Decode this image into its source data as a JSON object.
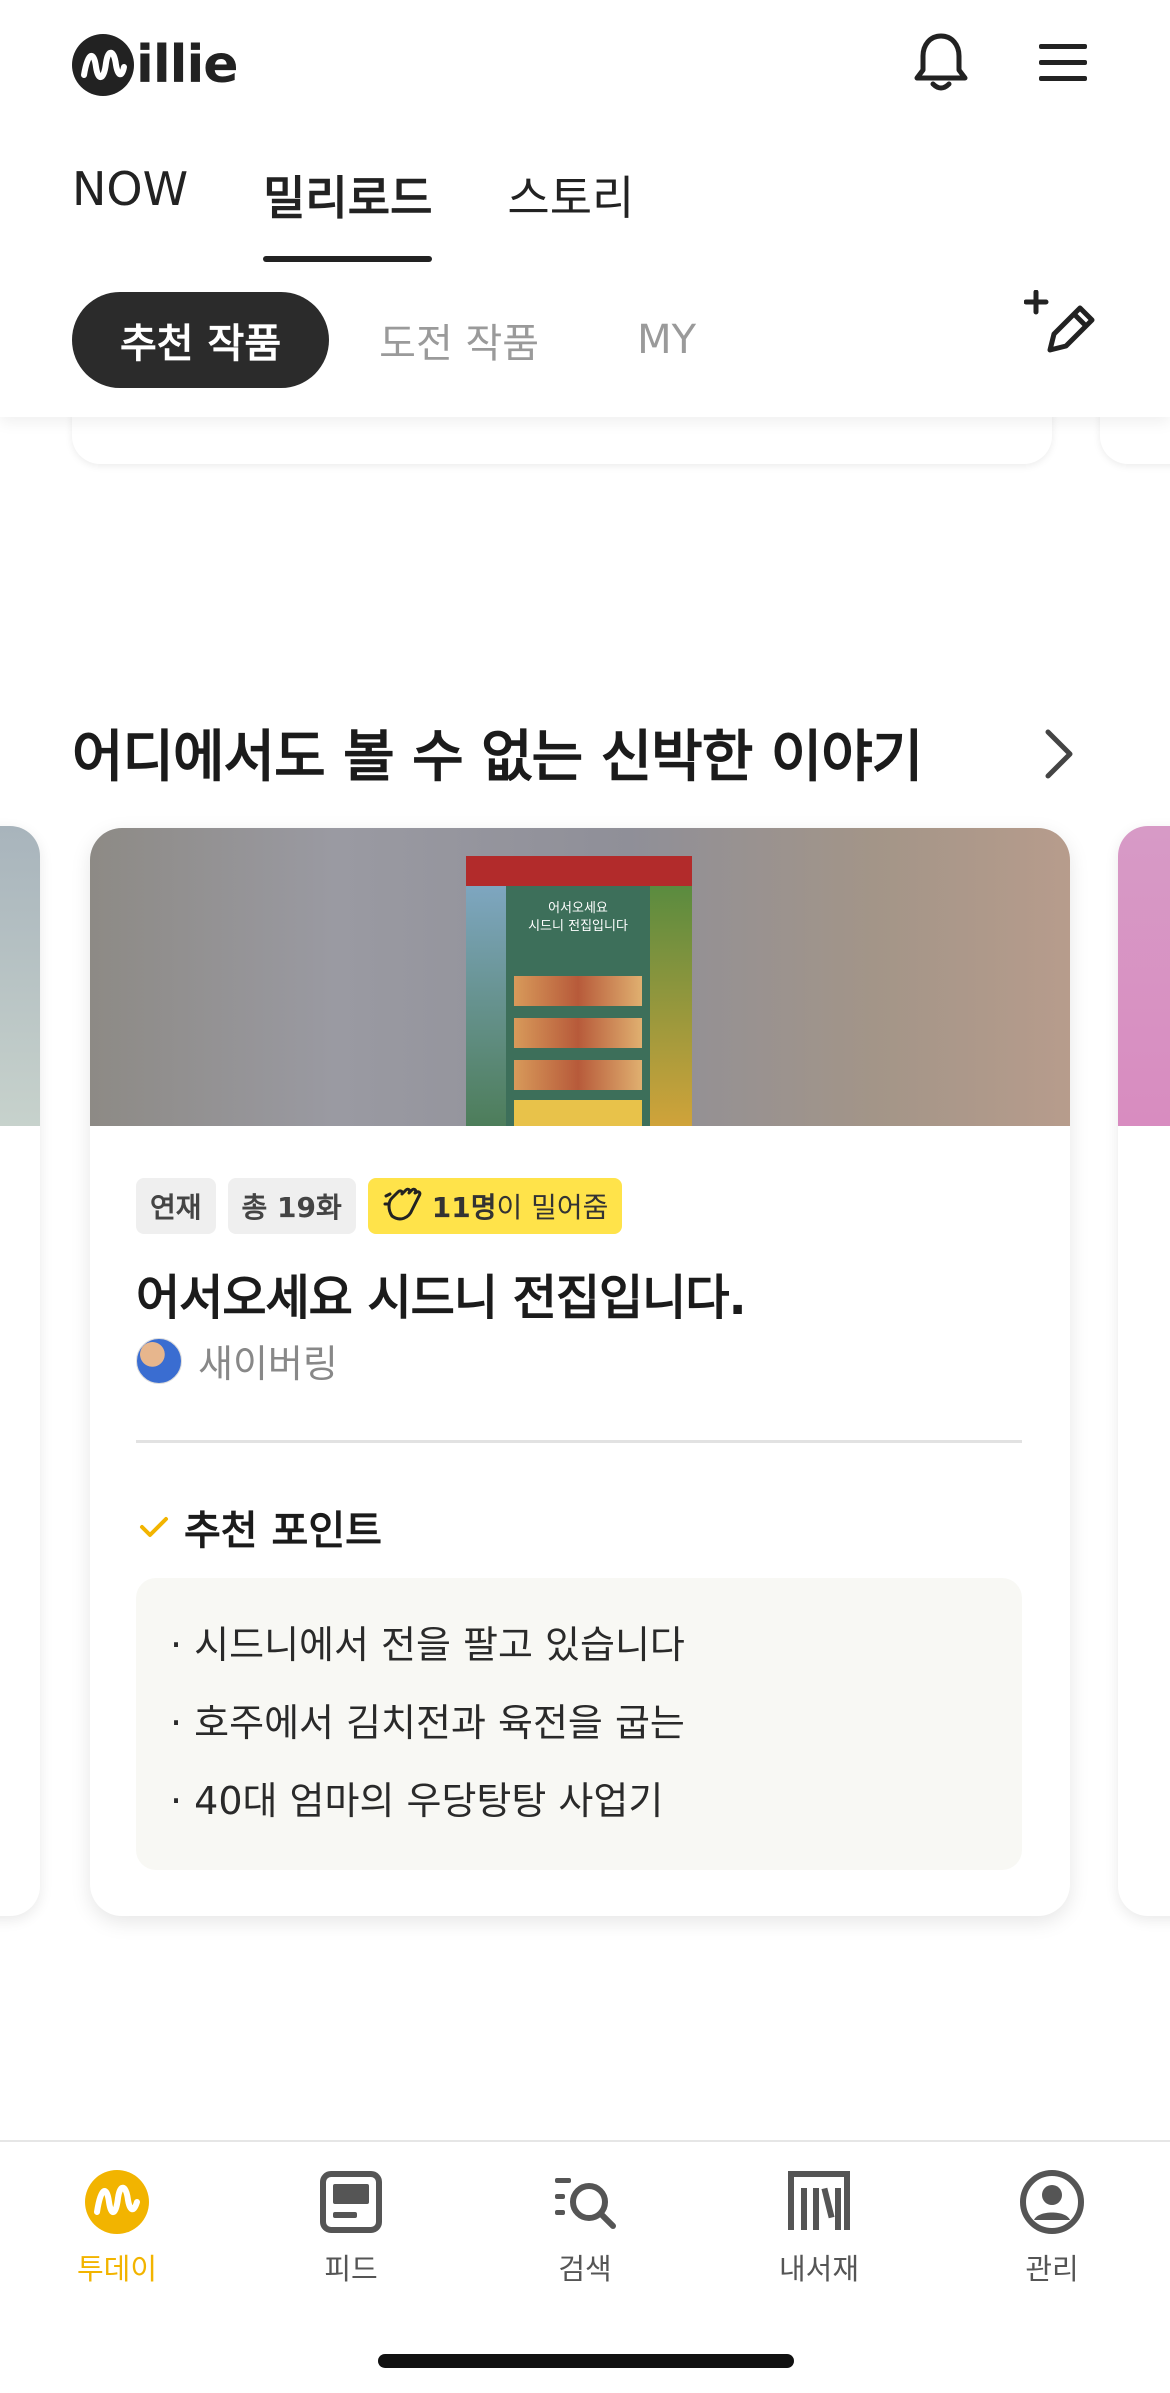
{
  "header": {
    "logo_text": "illie",
    "tabs": [
      {
        "label": "NOW"
      },
      {
        "label": "밀리로드"
      },
      {
        "label": "스토리"
      }
    ],
    "chips": [
      {
        "label": "추천 작품"
      },
      {
        "label": "도전 작품"
      },
      {
        "label": "MY"
      }
    ]
  },
  "section": {
    "title": "어디에서도 볼 수 없는 신박한 이야기",
    "card": {
      "cover_text_line1": "어서오세요",
      "cover_text_line2": "시드니 전집입니다",
      "badges": {
        "status": "연재",
        "episodes": "총 19화",
        "likes_count": "11명",
        "likes_suffix": "이 밀어줌"
      },
      "title": "어서오세요 시드니 전집입니다.",
      "author": "새이버링",
      "point_label": "추천 포인트",
      "points": [
        "· 시드니에서 전을 팔고 있습니다",
        "· 호주에서 김치전과 육전을 굽는",
        "· 40대 엄마의 우당탕탕 사업기"
      ]
    }
  },
  "bottom_nav": [
    {
      "label": "투데이",
      "icon": "today-icon",
      "active": true
    },
    {
      "label": "피드",
      "icon": "feed-icon"
    },
    {
      "label": "검색",
      "icon": "search-icon"
    },
    {
      "label": "내서재",
      "icon": "library-icon"
    },
    {
      "label": "관리",
      "icon": "profile-icon"
    }
  ],
  "colors": {
    "accent": "#f2b400",
    "like_badge": "#ffe34a",
    "chip_active": "#2b2b2b"
  }
}
